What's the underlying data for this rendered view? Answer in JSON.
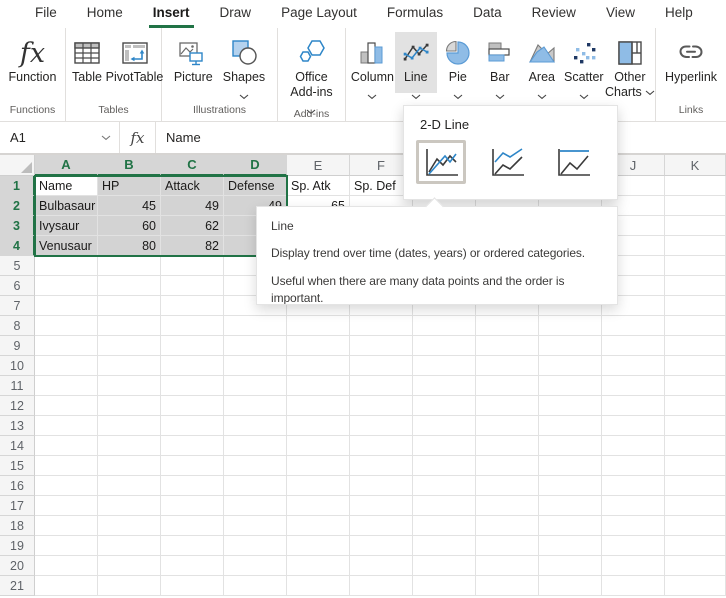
{
  "tabs": [
    "File",
    "Home",
    "Insert",
    "Draw",
    "Page Layout",
    "Formulas",
    "Data",
    "Review",
    "View",
    "Help"
  ],
  "active_tab": "Insert",
  "ribbon": {
    "function_label": "Function",
    "table_label": "Table",
    "pivottable_label": "PivotTable",
    "picture_label": "Picture",
    "shapes_label": "Shapes",
    "office_addins_line1": "Office",
    "office_addins_line2": "Add-ins",
    "column_label": "Column",
    "line_label": "Line",
    "pie_label": "Pie",
    "bar_label": "Bar",
    "area_label": "Area",
    "scatter_label": "Scatter",
    "other_charts_line1": "Other",
    "other_charts_line2": "Charts",
    "hyperlink_label": "Hyperlink",
    "groups": {
      "functions": "Functions",
      "tables": "Tables",
      "illustrations": "Illustrations",
      "addins": "Add-ins",
      "links": "Links"
    }
  },
  "formula_bar": {
    "name_box": "A1",
    "fx_symbol": "fx",
    "formula": "Name"
  },
  "dropdown": {
    "title": "2-D Line",
    "options": [
      "line-chart",
      "stacked-line-chart",
      "100-percent-stacked-line-chart"
    ],
    "selected_index": 0
  },
  "tooltip": {
    "title": "Line",
    "body1": "Display trend over time (dates, years) or ordered categories.",
    "body2": "Useful when there are many data points and the order is important."
  },
  "sheet": {
    "columns": [
      "A",
      "B",
      "C",
      "D",
      "E",
      "F",
      "G",
      "H",
      "I",
      "J",
      "K"
    ],
    "row_count": 21,
    "cells": {
      "A1": "Name",
      "B1": "HP",
      "C1": "Attack",
      "D1": "Defense",
      "E1": "Sp. Atk",
      "F1": "Sp. Def",
      "A2": "Bulbasaur",
      "B2": "45",
      "C2": "49",
      "D2": "49",
      "E2": "65",
      "A3": "Ivysaur",
      "B3": "60",
      "C3": "62",
      "A4": "Venusaur",
      "B4": "80",
      "C4": "82"
    },
    "selection": {
      "range": "A1:D4",
      "active_cell": "A1",
      "columns": [
        "A",
        "B",
        "C",
        "D"
      ],
      "rows": [
        1,
        2,
        3,
        4
      ]
    }
  },
  "colors": {
    "accent_green": "#217346",
    "selection_fill": "#d3d3d3",
    "chart_blue": "#8fbce6",
    "chart_blue_line": "#2e86c8",
    "chart_dark": "#3b3b3b"
  }
}
